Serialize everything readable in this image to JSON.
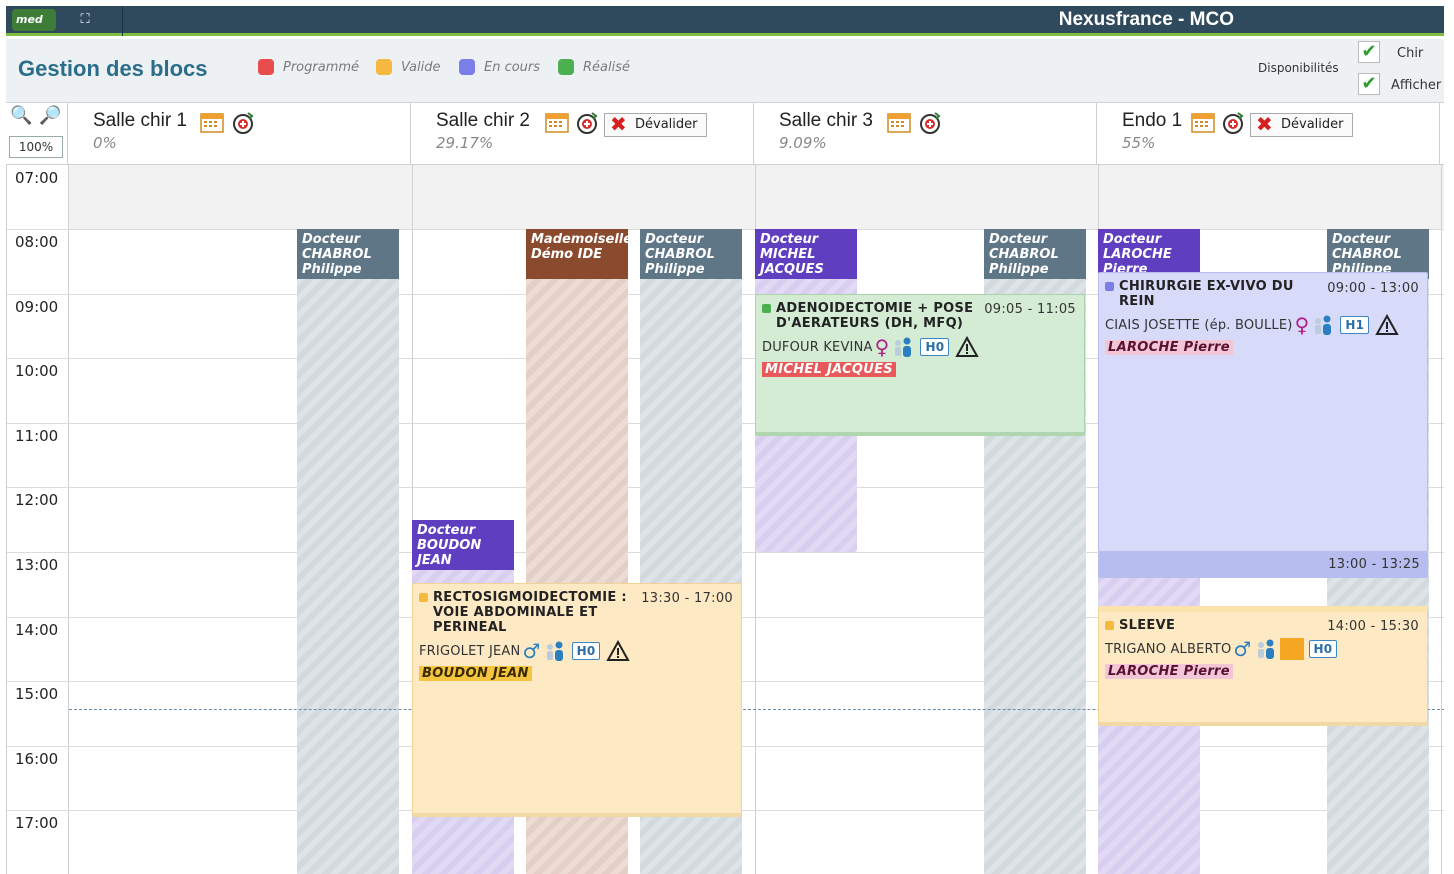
{
  "app": {
    "logo": "med",
    "title": "Nexusfrance - MCO"
  },
  "page": {
    "title": "Gestion des blocs"
  },
  "legend": [
    {
      "label": "Programmé",
      "color": "#e84c4c"
    },
    {
      "label": "Valide",
      "color": "#f5b942"
    },
    {
      "label": "En cours",
      "color": "#7b7de8"
    },
    {
      "label": "Réalisé",
      "color": "#4caf50"
    }
  ],
  "filters": {
    "dispo_label": "Disponibilités",
    "chir_label": "Chir",
    "afficher_label": "Afficher"
  },
  "zoom": {
    "value": "100%"
  },
  "actions": {
    "devalider": "Dévalider"
  },
  "rooms": [
    {
      "name": "Salle chir 1",
      "pct": "0%"
    },
    {
      "name": "Salle chir 2",
      "pct": "29.17%"
    },
    {
      "name": "Salle chir 3",
      "pct": "9.09%"
    },
    {
      "name": "Endo 1",
      "pct": "55%"
    }
  ],
  "hours": [
    "07:00",
    "08:00",
    "09:00",
    "10:00",
    "11:00",
    "12:00",
    "13:00",
    "14:00",
    "15:00",
    "16:00",
    "17:00"
  ],
  "lanes": {
    "r1_chabrol": "Docteur CHABROL Philippe",
    "r2_boudon": "Docteur BOUDON JEAN",
    "r2_demo": "Mademoiselle Démo IDE",
    "r2_chabrol": "Docteur CHABROL Philippe",
    "r3_michel": "Docteur MICHEL JACQUES",
    "r3_chabrol": "Docteur CHABROL Philippe",
    "r4_laroche": "Docteur LAROCHE Pierre",
    "r4_chabrol": "Docteur CHABROL Philippe"
  },
  "interventions": {
    "adeno": {
      "title": "ADENOIDECTOMIE + POSE D'AERATEURS (DH, MFQ)",
      "time": "09:05 - 11:05",
      "patient": "DUFOUR KEVINA",
      "badge": "H0",
      "surgeon": "MICHEL JACQUES",
      "status_color": "#4caf50"
    },
    "recto": {
      "title": "RECTOSIGMOIDECTOMIE : VOIE ABDOMINALE ET PERINEAL",
      "time": "13:30 - 17:00",
      "patient": "FRIGOLET JEAN",
      "badge": "H0",
      "surgeon": "BOUDON JEAN",
      "status_color": "#f5b942"
    },
    "rein": {
      "title": "CHIRURGIE EX-VIVO DU REIN",
      "time": "09:00 - 13:00",
      "patient": "CIAIS JOSETTE (ép. BOULLE)",
      "badge": "H1",
      "surgeon": "LAROCHE Pierre",
      "status_color": "#7b7de8",
      "post_time": "13:00 - 13:25"
    },
    "sleeve": {
      "title": "SLEEVE",
      "time": "14:00 - 15:30",
      "patient": "TRIGANO ALBERTO",
      "badge": "H0",
      "surgeon": "LAROCHE Pierre",
      "status_color": "#f5b942"
    }
  }
}
